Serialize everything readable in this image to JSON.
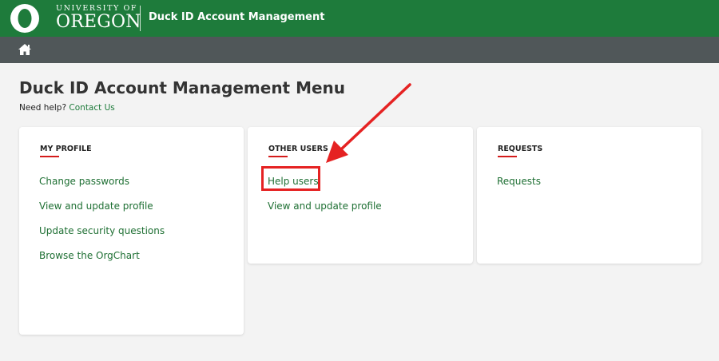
{
  "header": {
    "university_line": "UNIVERSITY OF",
    "university_name": "OREGON",
    "app_title": "Duck ID Account Management",
    "brand_color": "#1e7b3b"
  },
  "nav": {
    "home_icon": "home-icon",
    "bar_color": "#505759"
  },
  "page": {
    "title": "Duck ID Account Management Menu",
    "help_prefix": "Need help?",
    "help_link": "Contact Us"
  },
  "cards": {
    "my_profile": {
      "heading": "MY PROFILE",
      "links": [
        "Change passwords",
        "View and update profile",
        "Update security questions",
        "Browse the OrgChart"
      ]
    },
    "other_users": {
      "heading": "OTHER USERS",
      "links": [
        "Help users",
        "View and update profile"
      ]
    },
    "requests": {
      "heading": "REQUESTS",
      "links": [
        "Requests"
      ]
    }
  },
  "annotation": {
    "color": "#e52222"
  }
}
